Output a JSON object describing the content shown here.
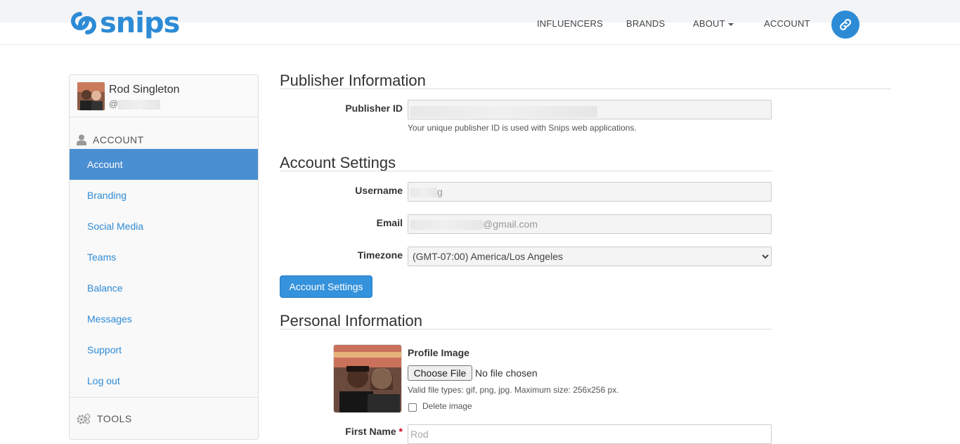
{
  "header": {
    "logo_text": "snips",
    "nav": [
      {
        "label": "INFLUENCERS"
      },
      {
        "label": "BRANDS"
      },
      {
        "label": "ABOUT"
      },
      {
        "label": "ACCOUNT"
      }
    ],
    "link_icon": "link-icon",
    "accent_color": "#2d8bd6"
  },
  "sidebar": {
    "profile": {
      "name": "Rod Singleton",
      "handle_prefix": "@"
    },
    "account_section": {
      "title": "ACCOUNT",
      "icon": "user-icon"
    },
    "items": [
      {
        "label": "Account",
        "active": true
      },
      {
        "label": "Branding"
      },
      {
        "label": "Social Media"
      },
      {
        "label": "Teams"
      },
      {
        "label": "Balance"
      },
      {
        "label": "Messages"
      },
      {
        "label": "Support"
      },
      {
        "label": "Log out"
      }
    ],
    "tools_section": {
      "title": "TOOLS",
      "icon": "gears-icon"
    }
  },
  "publisher": {
    "heading": "Publisher Information",
    "id_label": "Publisher ID",
    "id_help": "Your unique publisher ID is used with Snips web applications."
  },
  "account_settings": {
    "heading": "Account Settings",
    "username_label": "Username",
    "username_value_suffix": "g",
    "email_label": "Email",
    "email_value_suffix": "@gmail.com",
    "timezone_label": "Timezone",
    "timezone_value": "(GMT-07:00) America/Los Angeles",
    "submit_label": "Account Settings"
  },
  "personal": {
    "heading": "Personal Information",
    "profile_image_label": "Profile Image",
    "choose_file_label": "Choose File",
    "no_file_text": "No file chosen",
    "file_help": "Valid file types: gif, png, jpg. Maximum size: 256x256 px.",
    "delete_image_label": "Delete image",
    "first_name_label": "First Name",
    "required_mark": "*",
    "first_name_value": "Rod"
  }
}
